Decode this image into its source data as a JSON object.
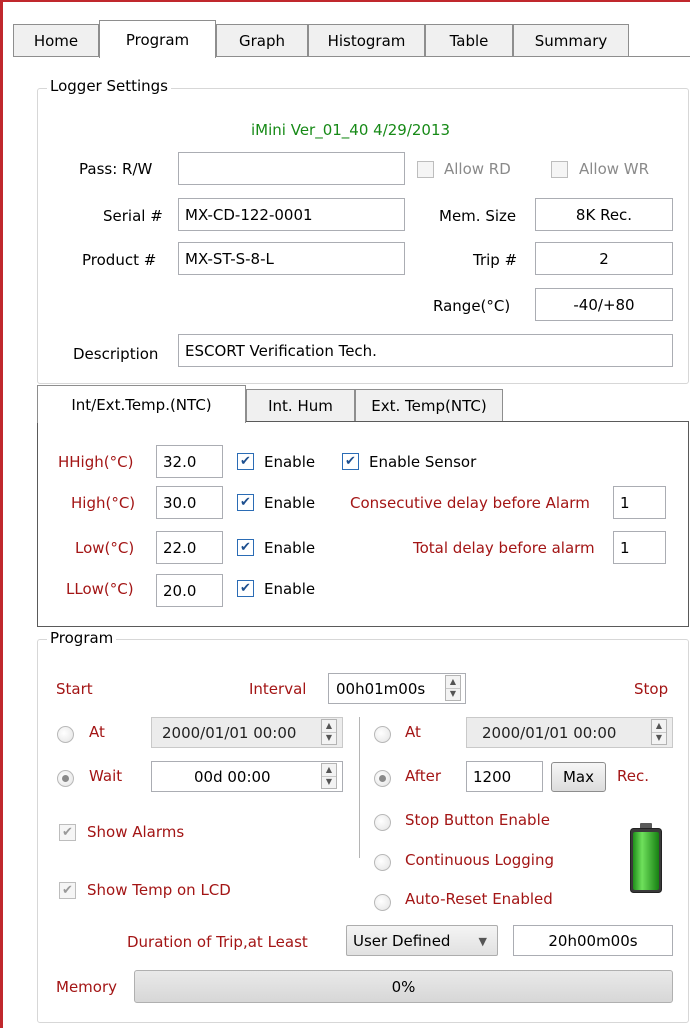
{
  "tabs": [
    "Home",
    "Program",
    "Graph",
    "Histogram",
    "Table",
    "Summary"
  ],
  "logger_settings": {
    "legend": "Logger Settings",
    "version": "iMini Ver_01_40 4/29/2013",
    "pass_label": "Pass: R/W",
    "pass_value": "",
    "allow_rd": "Allow RD",
    "allow_wr": "Allow WR",
    "serial_label": "Serial #",
    "serial_value": "MX-CD-122-0001",
    "mem_label": "Mem. Size",
    "mem_value": "8K Rec.",
    "product_label": "Product #",
    "product_value": "MX-ST-S-8-L",
    "trip_label": "Trip #",
    "trip_value": "2",
    "range_label": "Range(°C)",
    "range_value": "-40/+80",
    "desc_label": "Description",
    "desc_value": "ESCORT Verification Tech."
  },
  "sensor_tabs": [
    "Int/Ext.Temp.(NTC)",
    "Int. Hum",
    "Ext. Temp(NTC)"
  ],
  "sensor": {
    "hhigh_label": "HHigh(°C)",
    "hhigh_value": "32.0",
    "high_label": "High(°C)",
    "high_value": "30.0",
    "low_label": "Low(°C)",
    "low_value": "22.0",
    "llow_label": "LLow(°C)",
    "llow_value": "20.0",
    "enable": "Enable",
    "enable_sensor": "Enable Sensor",
    "consec_label": "Consecutive delay before Alarm",
    "consec_value": "1",
    "total_label": "Total delay before alarm",
    "total_value": "1"
  },
  "program": {
    "legend": "Program",
    "start": "Start",
    "interval_label": "Interval",
    "interval_value": "00h01m00s",
    "stop": "Stop",
    "at": "At",
    "start_at_value": "2000/01/01 00:00",
    "wait": "Wait",
    "wait_value": "00d 00:00",
    "stop_at_value": "2000/01/01 00:00",
    "after": "After",
    "after_value": "1200",
    "max_button": "Max",
    "rec": "Rec.",
    "stop_button_enable": "Stop Button Enable",
    "continuous_logging": "Continuous Logging",
    "auto_reset": "Auto-Reset Enabled",
    "show_alarms": "Show Alarms",
    "show_temp_lcd": "Show Temp on LCD",
    "duration_label": "Duration of Trip,at Least",
    "duration_select": "User Defined",
    "duration_value": "20h00m00s",
    "memory_label": "Memory",
    "memory_value": "0%",
    "memory_fraction": 0
  },
  "colors": {
    "alarm_label": "#a31515",
    "version_text": "#178a17",
    "frame_border": "#c0282d",
    "battery_green": "#2fbe2a"
  }
}
